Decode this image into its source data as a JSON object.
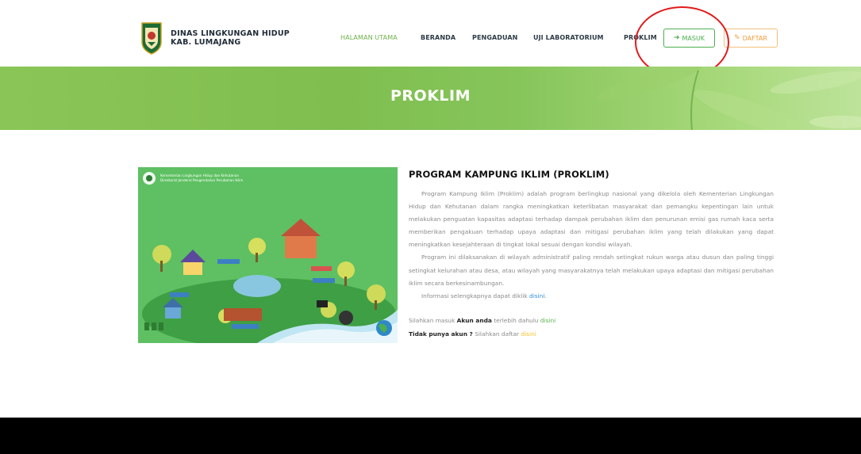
{
  "header": {
    "org_line1": "DINAS LINGKUNGAN HIDUP",
    "org_line2": "KAB. LUMAJANG",
    "nav": [
      {
        "label": "HALAMAN UTAMA"
      },
      {
        "label": "BERANDA"
      },
      {
        "label": "PENGADUAN"
      },
      {
        "label": "UJI LABORATORIUM"
      },
      {
        "label": "PROKLIM"
      }
    ],
    "masuk_label": "MASUK",
    "daftar_label": "DAFTAR"
  },
  "banner": {
    "title": "PROKLIM"
  },
  "illustration": {
    "caption_line1": "Kementerian Lingkungan Hidup dan Kehutanan",
    "caption_line2": "Direktorat Jenderal Pengendalian Perubahan Iklim"
  },
  "content": {
    "title": "PROGRAM KAMPUNG IKLIM (PROKLIM)",
    "p1": "Program Kampung Iklim (Proklim) adalah program berlingkup nasional yang dikelola oleh Kementerian Lingkungan Hidup dan Kehutanan dalam rangka meningkatkan keterlibatan masyarakat dan pemangku kepentingan lain untuk melakukan penguatan kapasitas adaptasi terhadap dampak perubahan iklim dan penurunan emisi gas rumah kaca serta memberikan pengakuan terhadap upaya adaptasi dan mitigasi perubahan iklim yang telah dilakukan yang dapat meningkatkan kesejahteraan di tingkat lokal sesuai dengan kondisi wilayah.",
    "p2": "Program ini dilaksanakan di wilayah administratif paling rendah setingkat rukun warga atau dusun dan paling tinggi setingkat kelurahan atau desa, atau wilayah yang masyarakatnya telah melakukan upaya adaptasi dan mitigasi perubahan iklim secara berkesinambungan.",
    "p3_text": "Informasi selengkapnya dapat diklik",
    "p3_link": "disini",
    "login_pre": "Silahkan masuk",
    "login_bold": "Akun anda",
    "login_mid": "terlebih dahulu",
    "login_link": "disini",
    "signup_bold": "Tidak punya akun ?",
    "signup_mid": "Silahkan daftar",
    "signup_link": "disini"
  },
  "colors": {
    "accent_green": "#6fb24c",
    "button_green": "#4caf50",
    "button_orange": "#ef9d3a",
    "link_blue": "#2c8fd8",
    "annotation_red": "#e11b1b",
    "footer": "#000000"
  }
}
